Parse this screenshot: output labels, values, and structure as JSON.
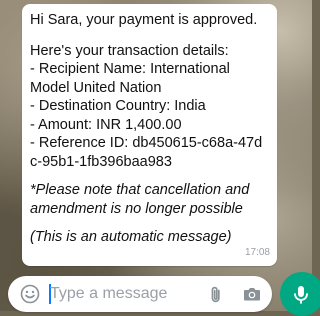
{
  "message": {
    "lines": [
      "Hi Sara, your payment is approved.",
      "Here's your transaction details:",
      "- Recipient Name: International",
      "Model United Nation",
      "- Destination Country: India",
      "- Amount: INR 1,400.00",
      "- Reference ID: db450615-c68a-47d",
      "c-95b1-1fb396baa983",
      "*Please note that cancellation and",
      "amendment is no longer possible",
      "(This is an automatic message)"
    ],
    "time": "17:08"
  },
  "composer": {
    "placeholder": "Type a message",
    "emoji_icon": "smiley-icon",
    "attach_icon": "paperclip-icon",
    "camera_icon": "camera-icon",
    "mic_icon": "microphone-icon"
  },
  "colors": {
    "accent": "#00a884",
    "bubble": "#ffffff",
    "timestamp": "#9aa0a6",
    "caret": "#0a7cff"
  }
}
